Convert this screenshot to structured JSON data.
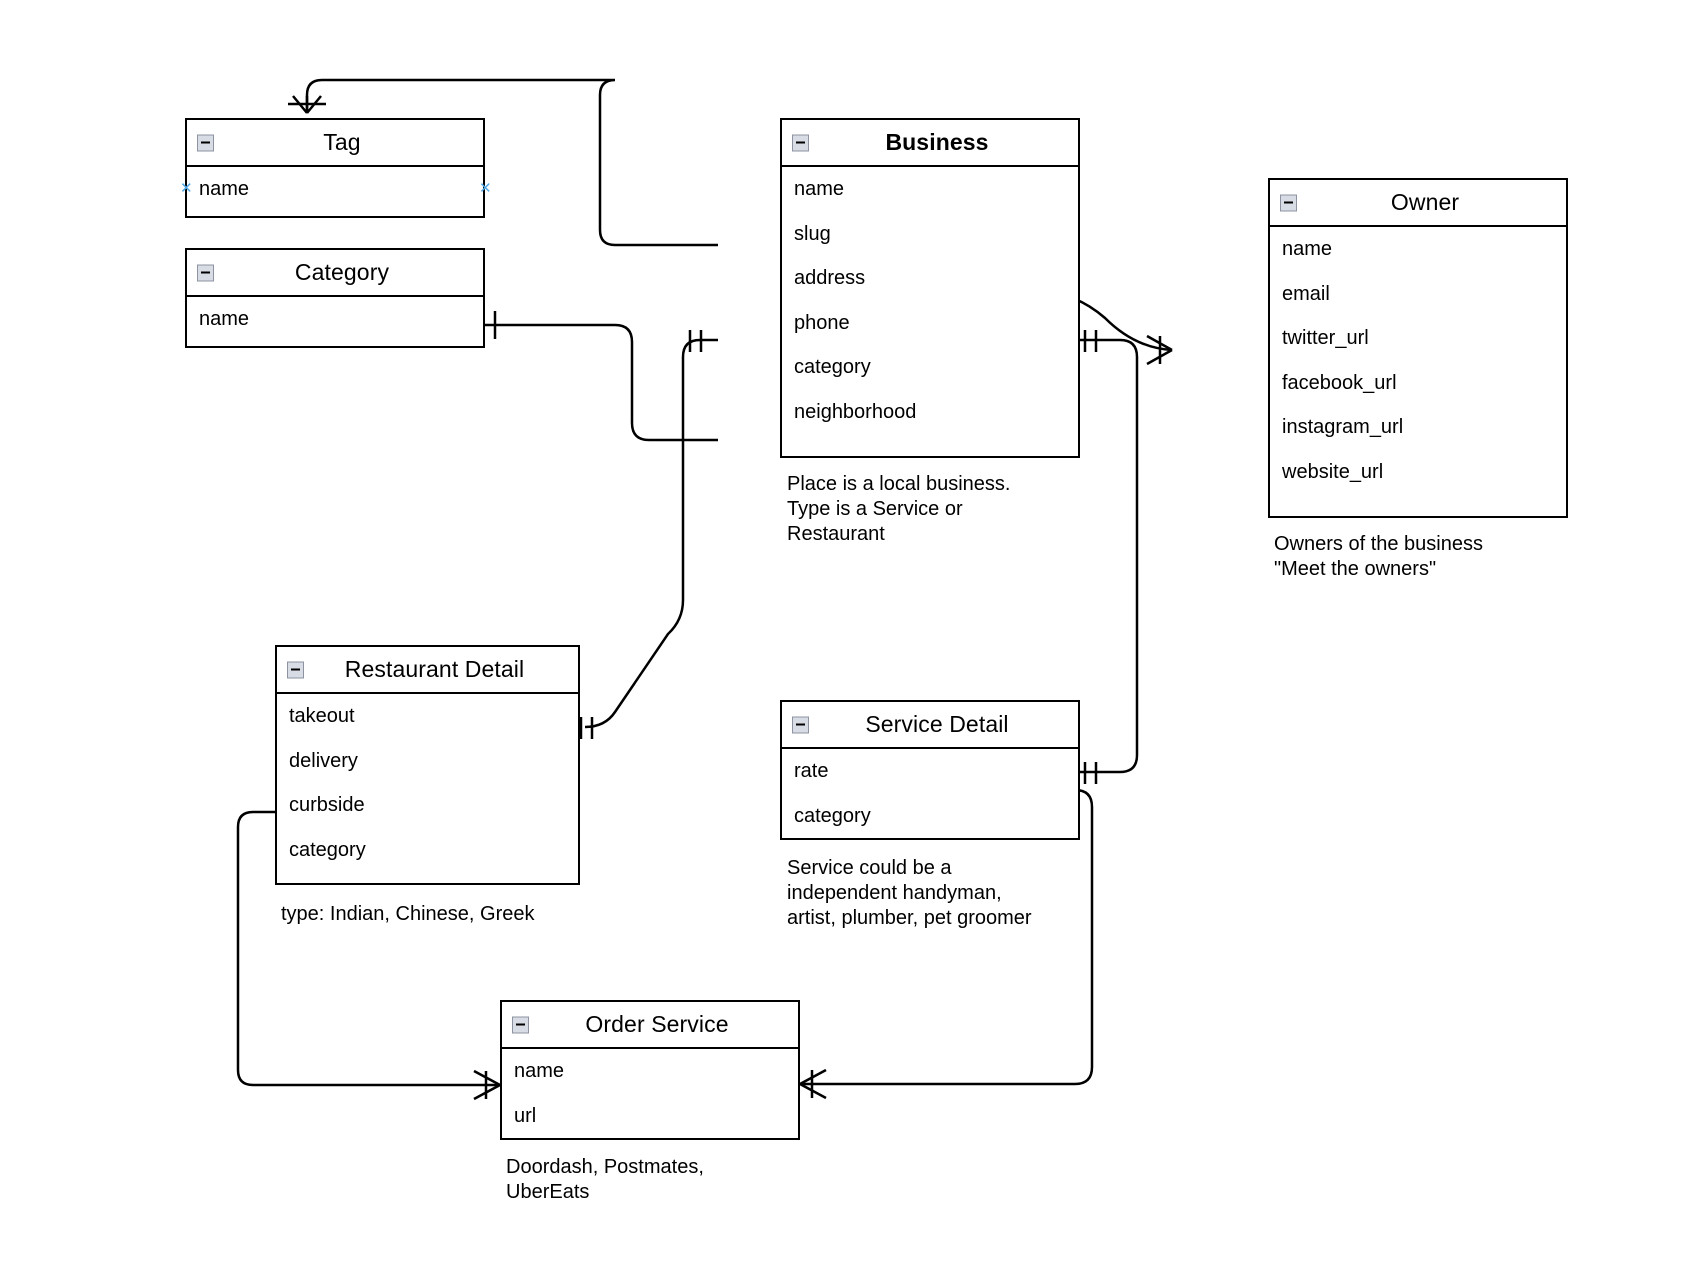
{
  "diagram": {
    "type": "entity-relationship-diagram",
    "background": "#ffffff",
    "line_color": "#000000",
    "handle_color": "#4fa8e8"
  },
  "entities": [
    {
      "id": "tag",
      "title": "Tag",
      "bold_title": false,
      "fields": [
        "name"
      ],
      "note": ""
    },
    {
      "id": "category",
      "title": "Category",
      "bold_title": false,
      "fields": [
        "name"
      ],
      "note": ""
    },
    {
      "id": "business",
      "title": "Business",
      "bold_title": true,
      "fields": [
        "name",
        "slug",
        "address",
        "phone",
        "category",
        "neighborhood"
      ],
      "note": "Place is a local business.\nType is a Service or\nRestaurant"
    },
    {
      "id": "owner",
      "title": "Owner",
      "bold_title": false,
      "fields": [
        "name",
        "email",
        "twitter_url",
        "facebook_url",
        "instagram_url",
        "website_url"
      ],
      "note": "Owners of the business\n\"Meet the owners\""
    },
    {
      "id": "restaurant_detail",
      "title": "Restaurant Detail",
      "bold_title": false,
      "fields": [
        "takeout",
        "delivery",
        "curbside",
        "category"
      ],
      "note": "type: Indian, Chinese, Greek"
    },
    {
      "id": "service_detail",
      "title": "Service Detail",
      "bold_title": false,
      "fields": [
        "rate",
        "category"
      ],
      "note": "Service could be a\nindependent handyman,\nartist, plumber, pet groomer"
    },
    {
      "id": "order_service",
      "title": "Order Service",
      "bold_title": false,
      "fields": [
        "name",
        "url"
      ],
      "note": "Doordash, Postmates,\nUberEats"
    }
  ],
  "relationships": [
    {
      "from": "business",
      "to": "tag",
      "from_marker": "one",
      "to_marker": "many"
    },
    {
      "from": "category",
      "to": "business",
      "from_marker": "many",
      "to_marker": "one"
    },
    {
      "from": "business",
      "to": "restaurant_detail",
      "from_marker": "one",
      "to_marker": "one"
    },
    {
      "from": "business",
      "to": "owner",
      "from_marker": "one",
      "to_marker": "many"
    },
    {
      "from": "business",
      "to": "service_detail",
      "from_marker": "one",
      "to_marker": "one"
    },
    {
      "from": "business",
      "to": "order_service",
      "from_marker": "one",
      "to_marker": "many"
    },
    {
      "from": "restaurant_detail",
      "to": "order_service",
      "from_marker": "one",
      "to_marker": "many"
    }
  ],
  "icons": {
    "collapse": "collapse-minus-icon",
    "handle": "connection-handle-icon"
  }
}
